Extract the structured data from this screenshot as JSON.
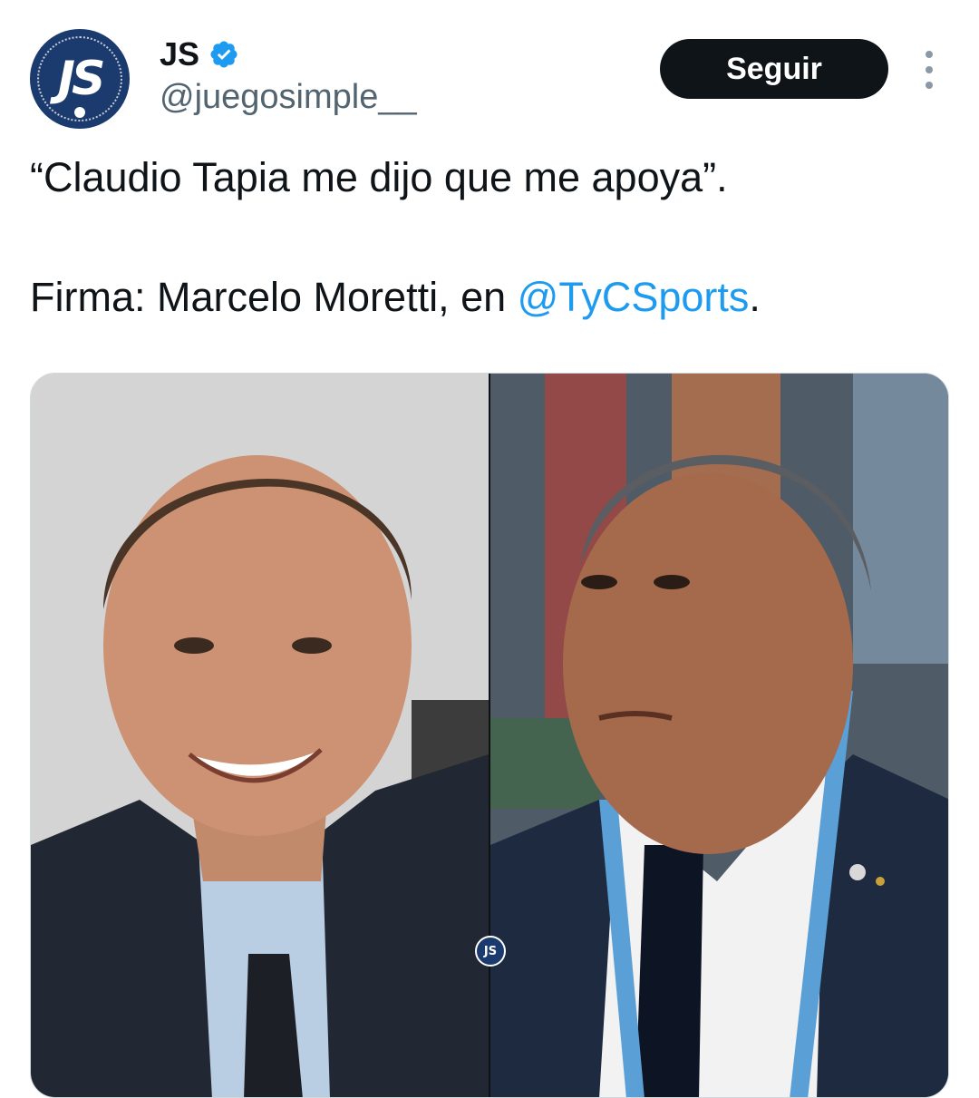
{
  "author": {
    "display_name": "JS",
    "handle": "@juegosimple__",
    "avatar_monogram": "JS",
    "verified_icon": "verified-badge-icon"
  },
  "actions": {
    "follow_label": "Seguir",
    "more_icon": "more-vertical-icon"
  },
  "tweet": {
    "line1": "“Claudio Tapia me dijo que me apoya”.",
    "line2_prefix": "Firma: Marcelo Moretti, en ",
    "line2_mention": "@TyCSports",
    "line2_suffix": "."
  },
  "media": {
    "watermark": "JS"
  },
  "colors": {
    "accent": "#1d9bf0",
    "follow_bg": "#0f1419",
    "brand_navy": "#1b3a6d"
  }
}
